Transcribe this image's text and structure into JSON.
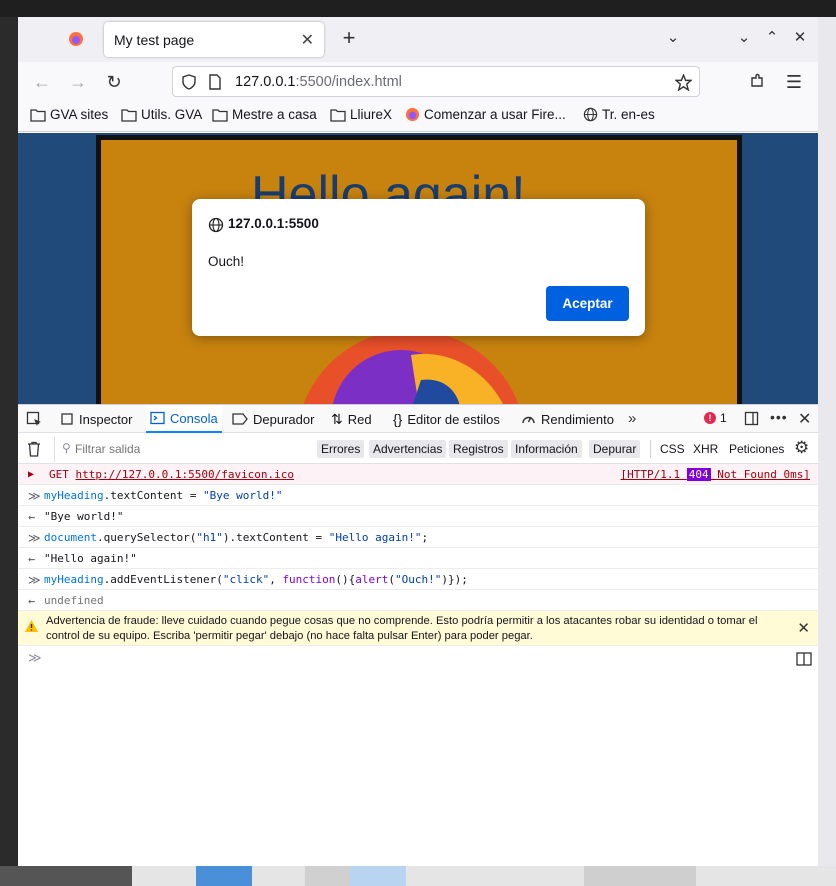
{
  "browser": {
    "tab_title": "My test page",
    "url_host": "127.0.0.1",
    "url_rest": ":5500/index.html"
  },
  "bookmarks": [
    {
      "label": "GVA sites",
      "icon": "folder-icon"
    },
    {
      "label": "Utils. GVA",
      "icon": "folder-icon"
    },
    {
      "label": "Mestre a casa",
      "icon": "folder-icon"
    },
    {
      "label": "LliureX",
      "icon": "folder-icon"
    },
    {
      "label": "Comenzar a usar Fire...",
      "icon": "firefox-icon"
    },
    {
      "label": "Tr. en-es",
      "icon": "globe-icon"
    }
  ],
  "page": {
    "heading": "Hello again!"
  },
  "dialog": {
    "origin": "127.0.0.1:5500",
    "message": "Ouch!",
    "ok_label": "Aceptar"
  },
  "devtools": {
    "tabs": [
      "Inspector",
      "Consola",
      "Depurador",
      "Red",
      "Editor de estilos",
      "Rendimiento"
    ],
    "error_count": "1",
    "filter_placeholder": "Filtrar salida",
    "filters": [
      "Errores",
      "Advertencias",
      "Registros",
      "Información",
      "Depurar"
    ],
    "filters_plain": [
      "CSS",
      "XHR",
      "Peticiones"
    ],
    "console": {
      "error_method": "GET",
      "error_url": "http://127.0.0.1:5500/favicon.ico",
      "error_status_pre": "[HTTP/1.1 ",
      "error_status_code": "404",
      "error_status_post": " Not Found 0ms]",
      "in1_obj": "myHeading",
      "in1_prop": ".textContent",
      "in1_op": " = ",
      "in1_str": "\"Bye world!\"",
      "out1": "\"Bye world!\"",
      "in2_obj": "document",
      "in2_fn": ".querySelector(",
      "in2_arg": "\"h1\"",
      "in2_rest": ").textContent",
      "in2_op": " = ",
      "in2_str": "\"Hello again!\"",
      "in2_end": ";",
      "out2": "\"Hello again!\"",
      "in3_obj": "myHeading",
      "in3_fn": ".addEventListener(",
      "in3_arg1": "\"click\"",
      "in3_mid": ", ",
      "in3_kw": "function",
      "in3_body1": "(){",
      "in3_alert": "alert",
      "in3_body2": "(",
      "in3_arg2": "\"Ouch!\"",
      "in3_end": ")});",
      "out3": "undefined",
      "warning": "Advertencia de fraude: lleve cuidado cuando pegue cosas que no comprende. Esto podría permitir a los atacantes robar su identidad o tomar el control de su equipo. Escriba 'permitir pegar' debajo (no hace falta pulsar Enter) para poder pegar."
    }
  },
  "colors": {
    "accent": "#0061e0",
    "page_bg": "#1f4a7a",
    "page_inner": "#c8830f"
  }
}
